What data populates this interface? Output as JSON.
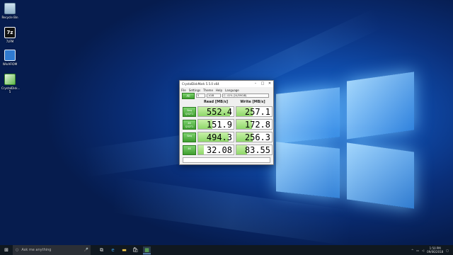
{
  "desktop": {
    "icons": [
      {
        "label": "Recycle Bin",
        "icon": "recycle-bin-icon"
      },
      {
        "label": "7zFM",
        "icon": "7zip-icon"
      },
      {
        "label": "WinAFIOM",
        "icon": "app-icon"
      },
      {
        "label": "CrystalDisk... 5",
        "icon": "crystaldisk-icon"
      }
    ]
  },
  "app": {
    "title": "CrystalDiskMark 5.5.0 x64",
    "menu": [
      "File",
      "Settings",
      "Theme",
      "Help",
      "Language"
    ],
    "all_label": "All",
    "count": "5",
    "size": "1GiB",
    "drive": "C: 41% (24/59GiB)",
    "headers": {
      "read": "Read [MB/s]",
      "write": "Write [MB/s]"
    },
    "rows": [
      {
        "label": "Seq Q32T1",
        "read": "552.4",
        "write": "257.1",
        "read_frac": 0.9,
        "write_frac": 0.45
      },
      {
        "label": "4K Q32T1",
        "read": "151.9",
        "write": "172.8",
        "read_frac": 0.4,
        "write_frac": 0.43
      },
      {
        "label": "Seq",
        "read": "494.3",
        "write": "256.3",
        "read_frac": 0.85,
        "write_frac": 0.45
      },
      {
        "label": "4K",
        "read": "32.08",
        "write": "83.55",
        "read_frac": 0.16,
        "write_frac": 0.3
      }
    ]
  },
  "taskbar": {
    "search_placeholder": "Ask me anything",
    "time": "1:50 PM",
    "date": "09/06/2018"
  }
}
